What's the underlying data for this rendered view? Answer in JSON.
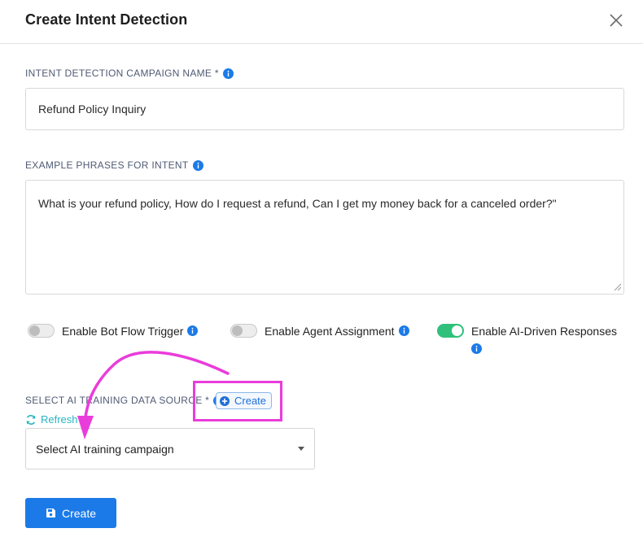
{
  "modal": {
    "title": "Create Intent Detection",
    "close_icon": "close-icon"
  },
  "campaign_name": {
    "label": "INTENT DETECTION CAMPAIGN NAME *",
    "value": "Refund Policy Inquiry",
    "info_icon": "info-icon"
  },
  "example_phrases": {
    "label": "EXAMPLE PHRASES FOR INTENT",
    "value": "What is your refund policy, How do I request a refund, Can I get my money back for a canceled order?\"",
    "info_icon": "info-icon"
  },
  "toggles": [
    {
      "label": "Enable Bot Flow Trigger",
      "enabled": false
    },
    {
      "label": "Enable Agent Assignment",
      "enabled": false
    },
    {
      "label": "Enable AI-Driven Responses",
      "enabled": true
    }
  ],
  "training_source": {
    "label": "SELECT AI TRAINING DATA SOURCE *",
    "create_label": "Create",
    "refresh_label": "Refresh",
    "select_placeholder": "Select AI training campaign"
  },
  "footer": {
    "create_button_label": "Create"
  },
  "colors": {
    "primary": "#1b7ae8",
    "toggle_on": "#2fc17b",
    "refresh": "#2ab4c2",
    "annotation": "#ea3cdb"
  }
}
